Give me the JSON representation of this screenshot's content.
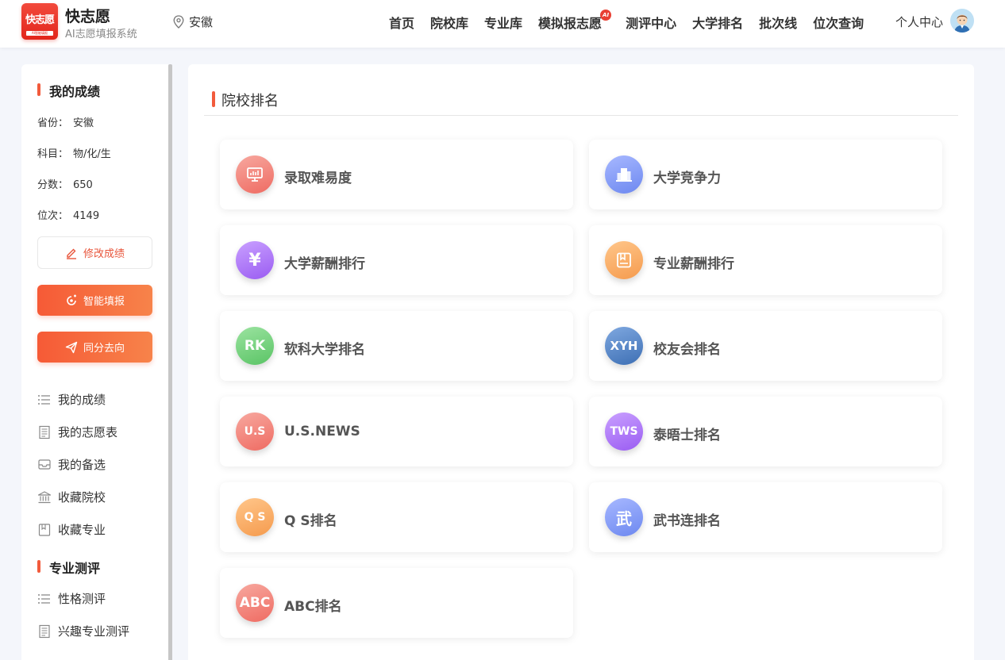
{
  "header": {
    "logo_text": "快志愿",
    "logo_sub": "AI智能填报",
    "brand_title": "快志愿",
    "brand_subtitle": "AI志愿填报系统",
    "location": "安徽",
    "nav": [
      {
        "label": "首页"
      },
      {
        "label": "院校库"
      },
      {
        "label": "专业库"
      },
      {
        "label": "模拟报志愿",
        "badge": "AI"
      },
      {
        "label": "测评中心"
      },
      {
        "label": "大学排名"
      },
      {
        "label": "批次线"
      },
      {
        "label": "位次查询"
      }
    ],
    "user_center": "个人中心"
  },
  "sidebar": {
    "scores_title": "我的成绩",
    "info": [
      {
        "label": "省份：",
        "value": "安徽"
      },
      {
        "label": "科目：",
        "value": "物/化/生"
      },
      {
        "label": "分数：",
        "value": "650"
      },
      {
        "label": "位次：",
        "value": "4149"
      }
    ],
    "edit_button": "修改成绩",
    "smart_button": "智能填报",
    "same_score_button": "同分去向",
    "menu": [
      {
        "label": "我的成绩",
        "icon": "list-icon"
      },
      {
        "label": "我的志愿表",
        "icon": "document-icon"
      },
      {
        "label": "我的备选",
        "icon": "inbox-icon"
      },
      {
        "label": "收藏院校",
        "icon": "university-icon"
      },
      {
        "label": "收藏专业",
        "icon": "bookmark-icon"
      }
    ],
    "eval_title": "专业测评",
    "eval_menu": [
      {
        "label": "性格测评",
        "icon": "list-icon"
      },
      {
        "label": "兴趣专业测评",
        "icon": "document-icon"
      }
    ]
  },
  "main": {
    "title": "院校排名",
    "cards": [
      {
        "label": "录取难易度",
        "icon_text": "",
        "icon": "monitor-icon",
        "color": "#ef6b62"
      },
      {
        "label": "大学竞争力",
        "icon_text": "",
        "icon": "building-icon",
        "color": "#6d88f0"
      },
      {
        "label": "大学薪酬排行",
        "icon_text": "¥",
        "icon": "yen-icon",
        "color": "#9a5cf2"
      },
      {
        "label": "专业薪酬排行",
        "icon_text": "",
        "icon": "book-icon",
        "color": "#f59b4e"
      },
      {
        "label": "软科大学排名",
        "icon_text": "RK",
        "icon": "rk-icon",
        "color": "#5ac465"
      },
      {
        "label": "校友会排名",
        "icon_text": "XYH",
        "icon": "xyh-icon",
        "color": "#3d6fb4"
      },
      {
        "label": "U.S.NEWS",
        "icon_text": "U.S",
        "icon": "usnews-icon",
        "color": "#ef6b62"
      },
      {
        "label": "泰晤士排名",
        "icon_text": "TWS",
        "icon": "tws-icon",
        "color": "#9a5cf2"
      },
      {
        "label": "Q S排名",
        "icon_text": "Q S",
        "icon": "qs-icon",
        "color": "#f59b4e"
      },
      {
        "label": "武书连排名",
        "icon_text": "武",
        "icon": "wsl-icon",
        "color": "#6d88f0"
      },
      {
        "label": "ABC排名",
        "icon_text": "ABC",
        "icon": "abc-icon",
        "color": "#ef6b62"
      }
    ]
  }
}
